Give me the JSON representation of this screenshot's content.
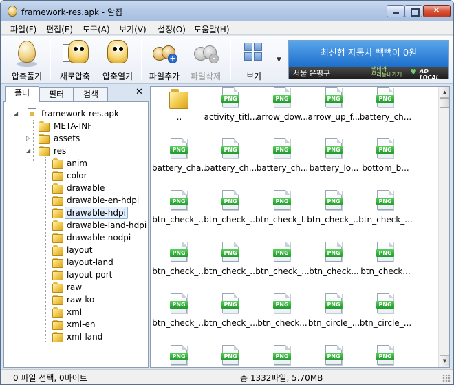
{
  "window": {
    "title": "framework-res.apk - 알집"
  },
  "menu": [
    "파일(F)",
    "편집(E)",
    "도구(A)",
    "보기(V)",
    "설정(O)",
    "도움말(H)"
  ],
  "toolbar": {
    "extract": "압축풀기",
    "new_archive": "새로압축",
    "open_archive": "압축열기",
    "add_file": "파일추가",
    "delete_file": "파일삭제",
    "view": "보기"
  },
  "banner": {
    "headline": "최신형 자동차 빽빽이 0원",
    "location": "서울 은평구",
    "brand1": "맵네라\n우리동네가게",
    "brand2": "AD LOCAL"
  },
  "left_tabs": [
    "폴더",
    "필터",
    "검색"
  ],
  "tree": {
    "root": "framework-res.apk",
    "level1": [
      "META-INF",
      "assets",
      "res"
    ],
    "res_children": [
      "anim",
      "color",
      "drawable",
      "drawable-en-hdpi",
      "drawable-hdpi",
      "drawable-land-hdpi",
      "drawable-nodpi",
      "layout",
      "layout-land",
      "layout-port",
      "raw",
      "raw-ko",
      "xml",
      "xml-en",
      "xml-land"
    ],
    "selected": "drawable-hdpi"
  },
  "file_type_badge": "PNG",
  "files": [
    "..",
    "activity_titl...",
    "arrow_dow...",
    "arrow_up_f...",
    "battery_ch...",
    "battery_cha...",
    "battery_ch...",
    "battery_ch...",
    "battery_lo...",
    "bottom_b...",
    "btn_check_...",
    "btn_check_...",
    "btn_check_l...",
    "btn_check_...",
    "btn_check_...",
    "btn_check_...",
    "btn_check_...",
    "btn_check_...",
    "btn_check...",
    "btn_check...",
    "btn_check_...",
    "btn_check_...",
    "btn_check...",
    "btn_circle_...",
    "btn_circle_...",
    "",
    "",
    "",
    "",
    ""
  ],
  "status": {
    "selection": "0 파일 선택,  0바이트",
    "total": "총 1332파일,  5.70MB"
  }
}
